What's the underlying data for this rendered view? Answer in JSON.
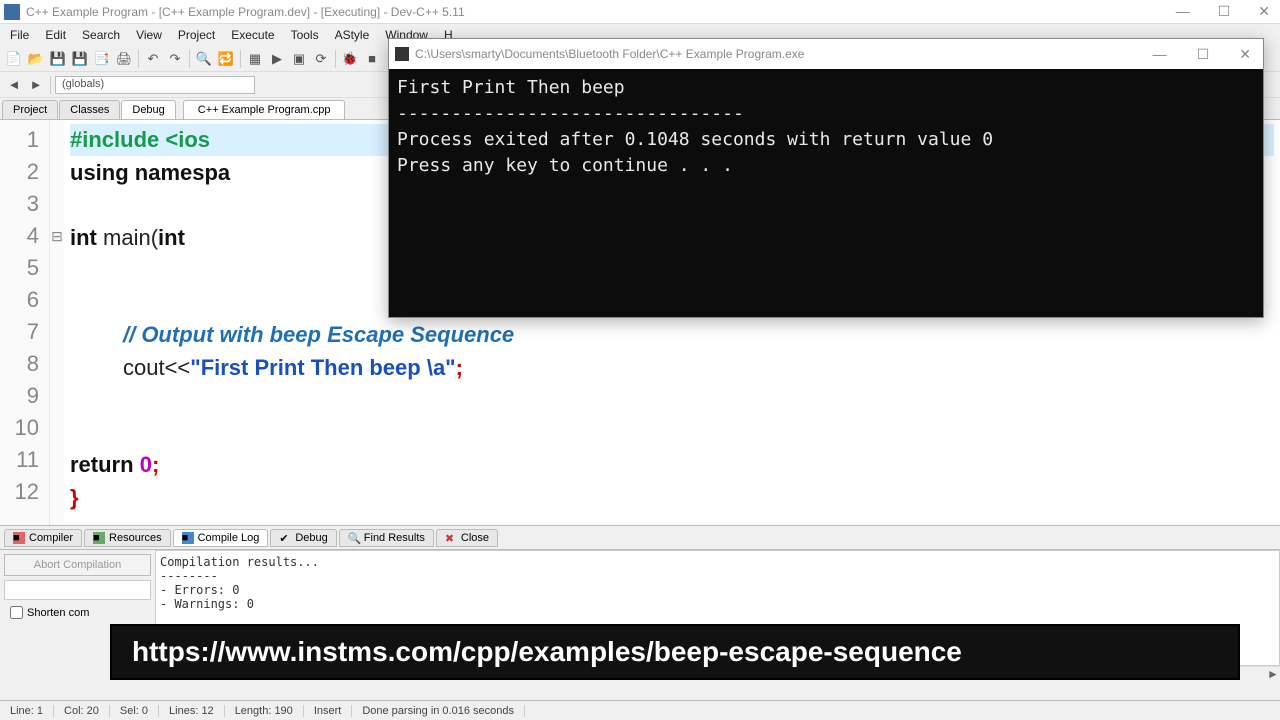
{
  "window": {
    "title": "C++ Example Program - [C++ Example Program.dev] - [Executing] - Dev-C++ 5.11"
  },
  "menu": [
    "File",
    "Edit",
    "Search",
    "View",
    "Project",
    "Execute",
    "Tools",
    "AStyle",
    "Window",
    "H"
  ],
  "globals_label": "(globals)",
  "left_tabs": {
    "project": "Project",
    "classes": "Classes",
    "debug": "Debug"
  },
  "file_tab": "C++ Example Program.cpp",
  "code": {
    "line1": "#include <ios",
    "line2a": "using",
    "line2b": " namespa",
    "line4a": "int",
    "line4b": " main(",
    "line4c": "int",
    "line7_cmt": "// Output with beep Escape Sequence",
    "line8_a": "cout<<",
    "line8_str": "\"First Print Then beep \\a\"",
    "line8_semi": ";",
    "line11a": "return ",
    "line11b": "0",
    "line11c": ";",
    "line12": "}"
  },
  "line_numbers": [
    "1",
    "2",
    "3",
    "4",
    "5",
    "6",
    "7",
    "8",
    "9",
    "10",
    "11",
    "12"
  ],
  "fold_marker": "⊟",
  "bottom": {
    "tabs": {
      "compiler": "Compiler",
      "resources": "Resources",
      "compile_log": "Compile Log",
      "debug": "Debug",
      "find": "Find Results",
      "close": "Close"
    },
    "abort": "Abort Compilation",
    "shorten": "Shorten com",
    "log_text": "Compilation results...\n--------\n- Errors: 0\n- Warnings: 0"
  },
  "status": {
    "line": "Line:   1",
    "col": "Col:   20",
    "sel": "Sel:   0",
    "lines": "Lines:   12",
    "length": "Length:   190",
    "insert": "Insert",
    "parse": "Done parsing in 0.016 seconds"
  },
  "console": {
    "title": "C:\\Users\\smarty\\Documents\\Bluetooth Folder\\C++ Example Program.exe",
    "body": "First Print Then beep\n--------------------------------\nProcess exited after 0.1048 seconds with return value 0\nPress any key to continue . . ."
  },
  "url_overlay": "https://www.instms.com/cpp/examples/beep-escape-sequence"
}
